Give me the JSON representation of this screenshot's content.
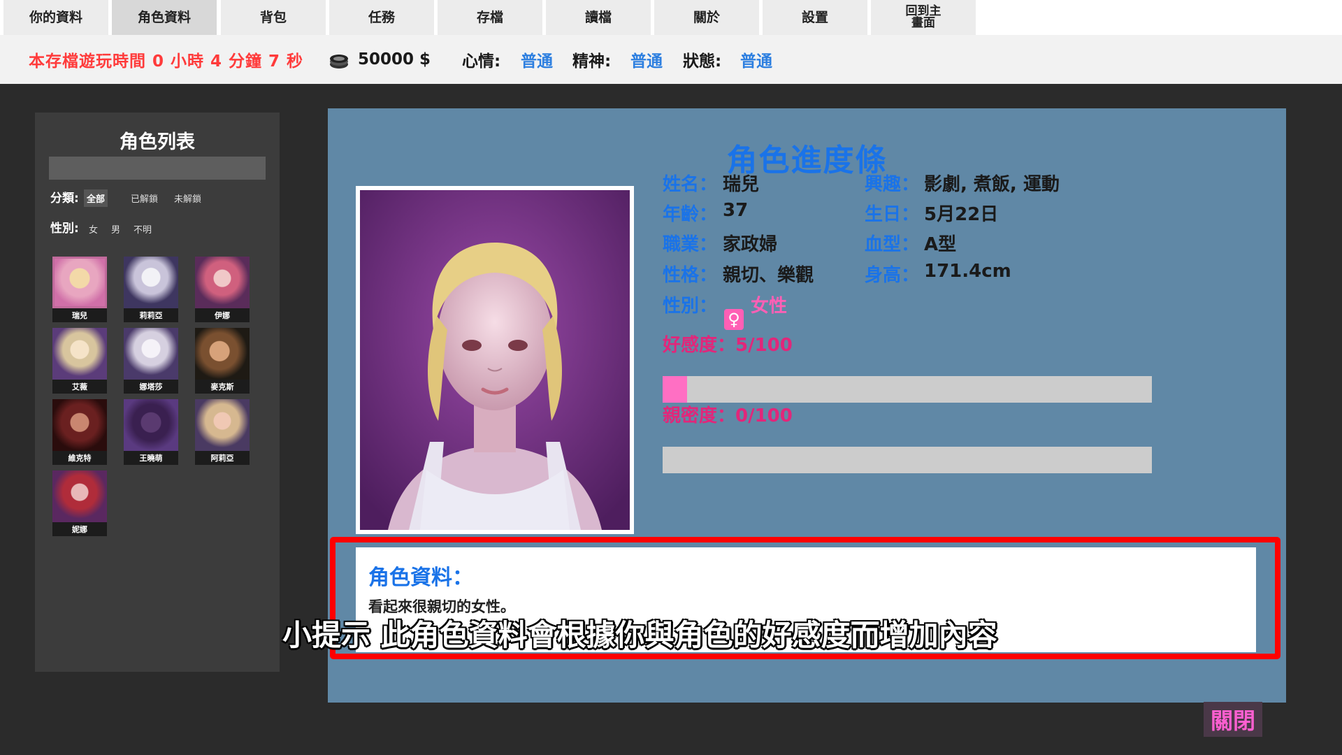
{
  "tabs": [
    {
      "label": "你的資料"
    },
    {
      "label": "角色資料"
    },
    {
      "label": "背包"
    },
    {
      "label": "任務"
    },
    {
      "label": "存檔"
    },
    {
      "label": "讀檔"
    },
    {
      "label": "關於"
    },
    {
      "label": "設置"
    },
    {
      "label": "回到主\n畫面"
    }
  ],
  "status": {
    "playtime": "本存檔遊玩時間 0 小時 4 分鐘 7 秒",
    "money": "50000 $",
    "mood_label": "心情:",
    "mood_value": "普通",
    "spirit_label": "精神:",
    "spirit_value": "普通",
    "state_label": "狀態:",
    "state_value": "普通"
  },
  "character_list": {
    "title": "角色列表",
    "category_label": "分類:",
    "category_options": [
      "全部",
      "已解鎖",
      "未解鎖"
    ],
    "gender_label": "性別:",
    "gender_options": [
      "女",
      "男",
      "不明"
    ],
    "characters": [
      {
        "name": "瑞兒"
      },
      {
        "name": "莉莉亞"
      },
      {
        "name": "伊娜"
      },
      {
        "name": "艾薇"
      },
      {
        "name": "娜塔莎"
      },
      {
        "name": "麥克斯"
      },
      {
        "name": "維克特"
      },
      {
        "name": "王曉萌"
      },
      {
        "name": "阿莉亞"
      },
      {
        "name": "妮娜"
      }
    ]
  },
  "profile": {
    "title": "角色進度條",
    "name_label": "姓名：",
    "name": "瑞兒",
    "age_label": "年齡：",
    "age": "37",
    "job_label": "職業：",
    "job": "家政婦",
    "personality_label": "性格：",
    "personality": "親切、樂觀",
    "gender_label": "性別：",
    "gender_icon": "♀",
    "gender": "女性",
    "hobby_label": "興趣：",
    "hobby": "影劇, 煮飯, 運動",
    "birthday_label": "生日：",
    "birthday": "5月22日",
    "blood_label": "血型：",
    "blood": "A型",
    "height_label": "身高：",
    "height": "171.4cm",
    "affection_label": "好感度：5/100",
    "affection_fraction": 0.05,
    "intimacy_label": "親密度：0/100",
    "intimacy_fraction": 0.0
  },
  "description": {
    "title": "角色資料：",
    "text": "看起來很親切的女性。"
  },
  "subtitle": "小提示 此角色資料會根據你與角色的好感度而增加內容",
  "close_label": "關閉",
  "colors": {
    "accent_blue": "#1a73e8",
    "panel_blue": "#6088a6",
    "affection_pink": "#ff6fc3",
    "highlight_red": "#ff0000"
  }
}
